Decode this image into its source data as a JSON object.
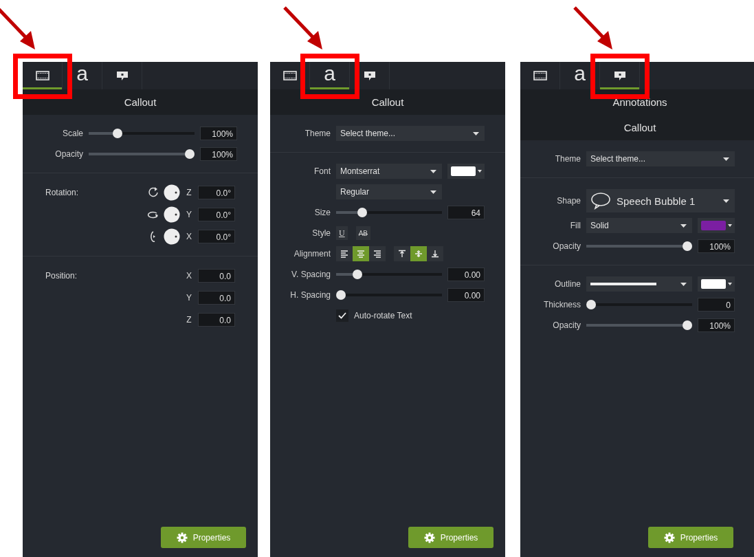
{
  "panels": [
    {
      "tabs": [
        {
          "kind": "film",
          "selected": true
        },
        {
          "kind": "letter",
          "text": "a",
          "selected": false
        },
        {
          "kind": "callout",
          "selected": false
        }
      ],
      "headers": [
        "Callout"
      ],
      "sections": [
        [
          {
            "kind": "slider",
            "label": "Scale",
            "level": 0.25,
            "value": "100%"
          },
          {
            "kind": "slider",
            "label": "Opacity",
            "level": 1,
            "value": "100%"
          }
        ],
        [
          {
            "kind": "rotation",
            "label": "Rotation:",
            "axis": "Z",
            "value": "0.0°"
          },
          {
            "kind": "rotation",
            "axis": "Y",
            "value": "0.0°"
          },
          {
            "kind": "rotation",
            "axis": "X",
            "value": "0.0°"
          }
        ],
        [
          {
            "kind": "position",
            "label": "Position:",
            "axis": "X",
            "value": "0.0"
          },
          {
            "kind": "position",
            "axis": "Y",
            "value": "0.0"
          },
          {
            "kind": "position",
            "axis": "Z",
            "value": "0.0"
          }
        ]
      ],
      "button": "Properties"
    },
    {
      "tabs": [
        {
          "kind": "film",
          "selected": false
        },
        {
          "kind": "letter",
          "text": "a",
          "selected": true
        },
        {
          "kind": "callout",
          "selected": false
        }
      ],
      "headers": [
        "Callout"
      ],
      "sections": [
        [
          {
            "kind": "wide-dropdown",
            "label": "Theme",
            "value": "Select theme..."
          }
        ],
        [
          {
            "kind": "dropdown",
            "label": "Font",
            "value": "Montserrat",
            "color": "#ffffff"
          },
          {
            "kind": "dropdown",
            "value": "Regular"
          },
          {
            "kind": "slider",
            "label": "Size",
            "level": 0.22,
            "value": "64"
          },
          {
            "kind": "style",
            "label": "Style",
            "options": [
              {
                "text": "U"
              },
              {
                "text": "AB"
              }
            ]
          },
          {
            "kind": "alignment",
            "label": "Alignment",
            "groups": [
              [
                {
                  "selected": false
                },
                {
                  "selected": true
                },
                {
                  "selected": false
                }
              ],
              [
                {
                  "selected": false
                },
                {
                  "selected": true
                },
                {
                  "selected": false
                }
              ]
            ]
          },
          {
            "kind": "slider",
            "label": "V. Spacing",
            "level": 0.17,
            "value": "0.00"
          },
          {
            "kind": "slider",
            "label": "H. Spacing",
            "level": 0.0,
            "value": "0.00"
          },
          {
            "kind": "checkbox",
            "label": "Auto-rotate Text",
            "checked": true
          }
        ]
      ],
      "button": "Properties"
    },
    {
      "tabs": [
        {
          "kind": "film",
          "selected": false
        },
        {
          "kind": "letter",
          "text": "a",
          "selected": false
        },
        {
          "kind": "callout",
          "selected": true
        }
      ],
      "headers": [
        "Annotations",
        "Callout"
      ],
      "sections": [
        [
          {
            "kind": "wide-dropdown",
            "label": "Theme",
            "value": "Select theme..."
          }
        ],
        [
          {
            "kind": "shape",
            "label": "Shape",
            "value": "Speech Bubble 1"
          },
          {
            "kind": "dropdown",
            "label": "Fill",
            "value": "Solid",
            "color": "#7b1fa2"
          },
          {
            "kind": "slider",
            "label": "Opacity",
            "level": 1,
            "value": "100%"
          }
        ],
        [
          {
            "kind": "outline",
            "label": "Outline",
            "color": "#ffffff"
          },
          {
            "kind": "slider",
            "label": "Thickness",
            "level": 0,
            "value": "0"
          },
          {
            "kind": "slider",
            "label": "Opacity",
            "level": 1,
            "value": "100%"
          }
        ]
      ],
      "button": "Properties"
    }
  ]
}
